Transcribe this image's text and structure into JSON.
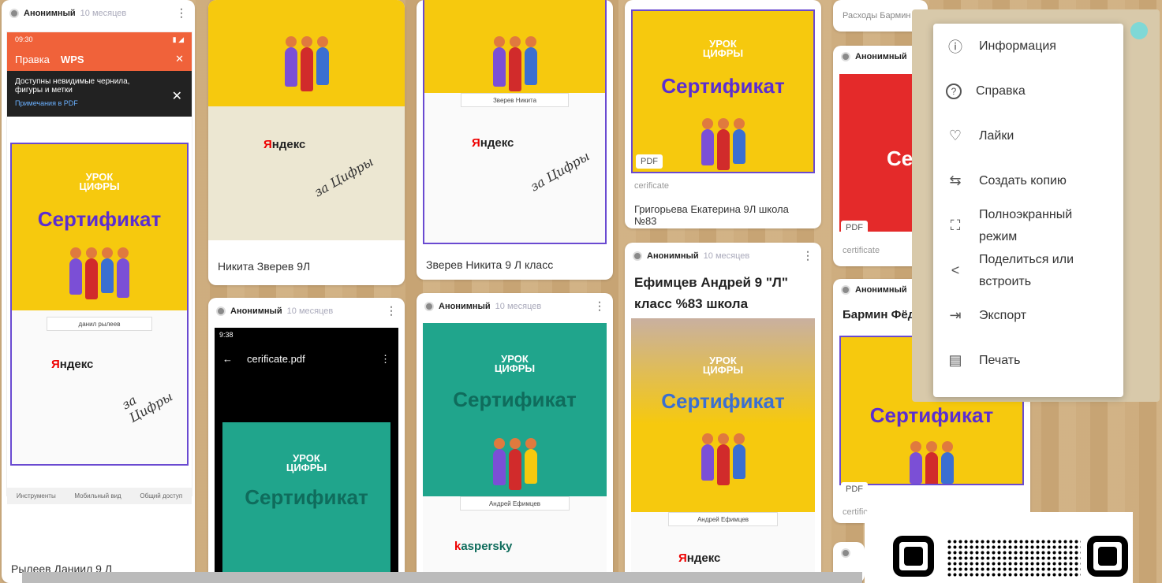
{
  "author": "Анонимный",
  "time_ago": "10 месяцев",
  "logo_line1": "УРОК",
  "logo_line2": "ЦИФРЫ",
  "cert_title": "Сертификат",
  "yandex": "Яндекс",
  "kaspersky": "kaspersky",
  "pdf_label": "PDF",
  "cert_file": "cerificate",
  "phone": {
    "time": "09:30",
    "app_title": "Правка",
    "app_brand": "WPS",
    "notice": "Доступны невидимые чернила, фигуры и метки",
    "notice_link": "Примечания в PDF",
    "student_name": "данил рылеев",
    "tools": [
      "Инструменты",
      "Мобильный вид",
      "Общий доступ"
    ]
  },
  "android": {
    "time": "9:38",
    "filename": "cerificate.pdf"
  },
  "cards": {
    "c1": "Рылеев Даниил 9 Л",
    "c2": "Никита Зверев 9Л",
    "c3": "Зверев Никита 9 Л класс",
    "c3_name": "Зверев Никита",
    "c4": "Григорьева Екатерина 9Л школа №83",
    "c5_title": "Ефимцев Андрей 9 \"Л\" класс %83 школа",
    "c5_name": "Андрей Ефимцев",
    "c6_name": "Андрей Ефимцев",
    "c7_top": "Расходы Бармин",
    "c8_title": "Бармин Фёд",
    "c8_file": "certific",
    "c9_file": "certificate"
  },
  "menu": [
    {
      "icon": "info-icon",
      "glyph": "ⓘ",
      "label": "Информация"
    },
    {
      "icon": "help-icon",
      "glyph": "?",
      "label": "Справка"
    },
    {
      "icon": "heart-icon",
      "glyph": "♡",
      "label": "Лайки"
    },
    {
      "icon": "copy-icon",
      "glyph": "⇆",
      "label": "Создать копию"
    },
    {
      "icon": "fullscreen-icon",
      "glyph": "⛶",
      "label": "Полноэкранный режим"
    },
    {
      "icon": "share-icon",
      "glyph": "<",
      "label": "Поделиться или встроить"
    },
    {
      "icon": "export-icon",
      "glyph": "⇥",
      "label": "Экспорт"
    },
    {
      "icon": "print-icon",
      "glyph": "▤",
      "label": "Печать"
    }
  ],
  "colors": {
    "accent": "#5b2ed1",
    "yellow": "#f6c90e",
    "green": "#20a58c",
    "red": "#e42a2a",
    "orange": "#f0623a"
  }
}
